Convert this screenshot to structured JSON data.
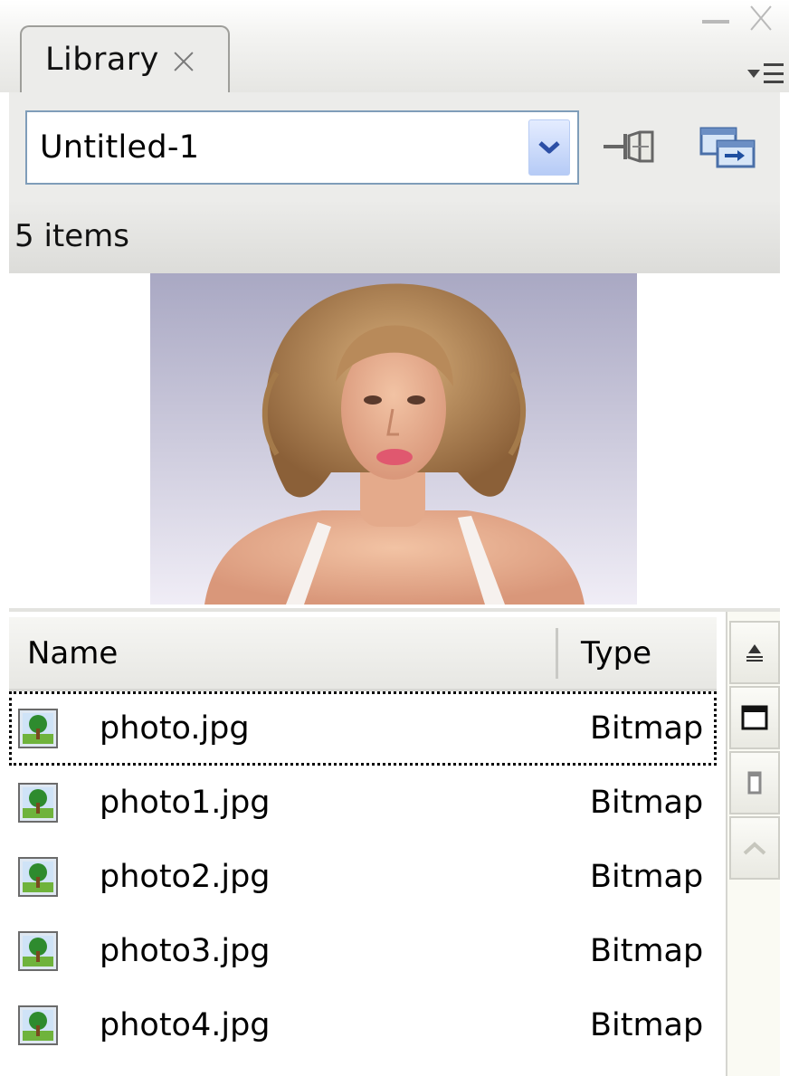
{
  "panel": {
    "tab_label": "Library"
  },
  "toolbar": {
    "document_value": "Untitled-1",
    "dropdown_icon": "chevron-down-icon",
    "pin_icon": "pin-library-icon",
    "new_library_icon": "new-library-panel-icon"
  },
  "status": {
    "items_count": "5 items"
  },
  "preview": {
    "description_icon": "bitmap-preview"
  },
  "list": {
    "columns": {
      "name": "Name",
      "type": "Type"
    },
    "rows": [
      {
        "name": "photo.jpg",
        "type": "Bitmap",
        "selected": true
      },
      {
        "name": "photo1.jpg",
        "type": "Bitmap"
      },
      {
        "name": "photo2.jpg",
        "type": "Bitmap"
      },
      {
        "name": "photo3.jpg",
        "type": "Bitmap"
      },
      {
        "name": "photo4.jpg",
        "type": "Bitmap"
      }
    ]
  },
  "side_tools": {
    "sort_icon": "sort-order-icon",
    "wide_icon": "wide-state-icon",
    "narrow_icon": "narrow-state-icon",
    "up_icon": "scroll-up-icon"
  },
  "colors": {
    "select_border": "#7f9db9",
    "dropdown_arrow": "#2c4fa6",
    "panel_bg": "#ececea"
  }
}
